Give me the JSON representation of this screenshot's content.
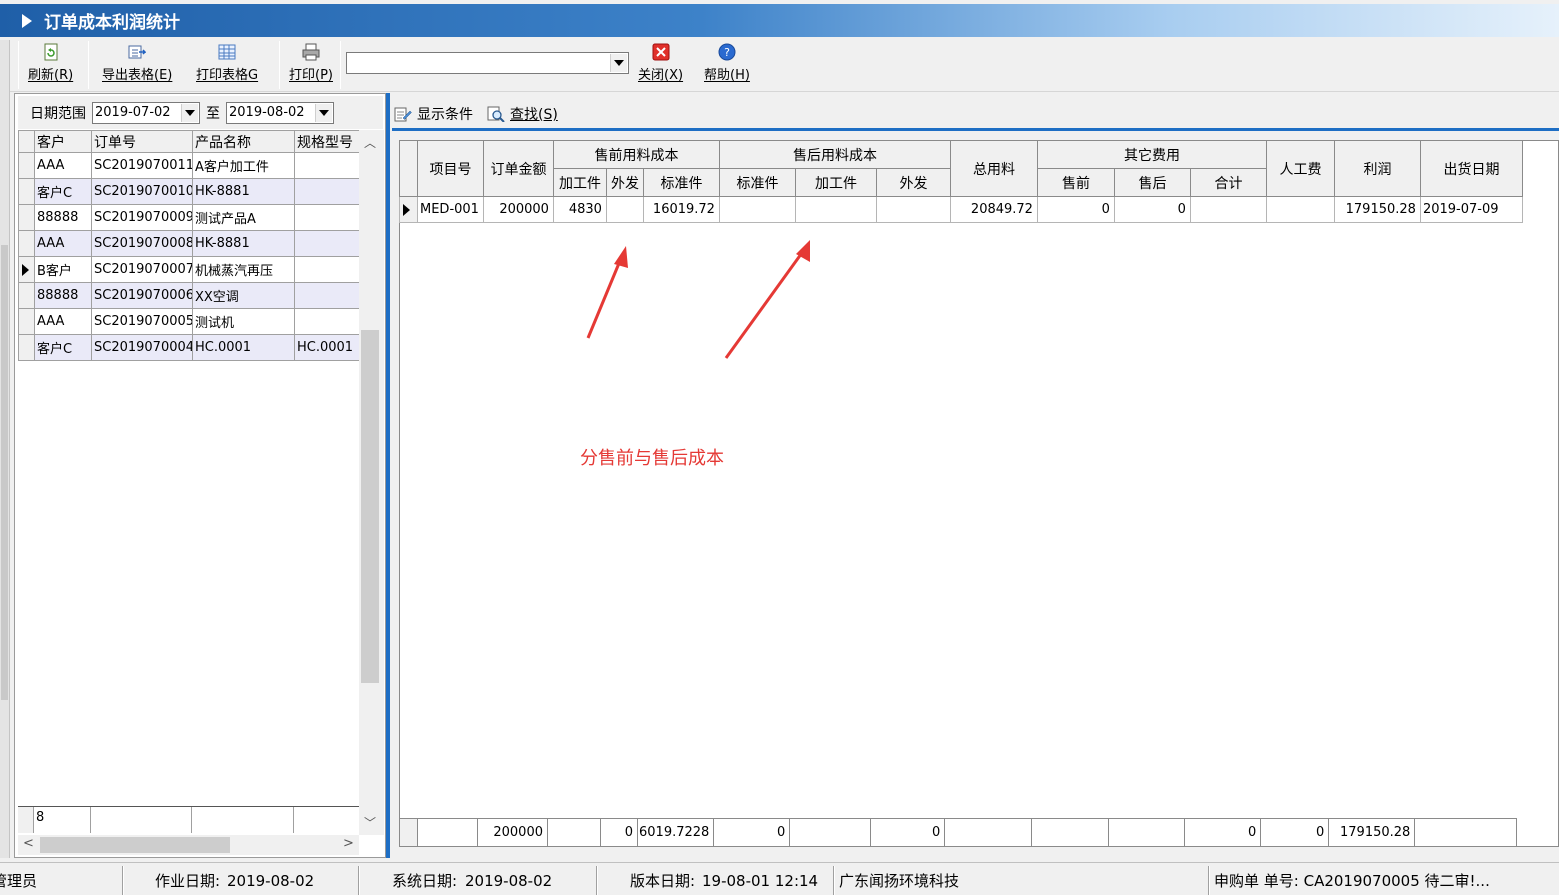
{
  "window": {
    "title": "订单成本利润统计"
  },
  "toolbar": {
    "refresh": "刷新(R)",
    "export": "导出表格(E)",
    "print_table": "打印表格G",
    "print": "打印(P)",
    "combo_value": "",
    "close": "关闭(X)",
    "help": "帮助(H)"
  },
  "filter": {
    "label": "日期范围",
    "from": "2019-07-02",
    "to_label": "至",
    "to": "2019-08-02"
  },
  "left_grid": {
    "columns": [
      "客户",
      "订单号",
      "产品名称",
      "规格型号"
    ],
    "rows": [
      [
        "AAA",
        "SC2019070011",
        "A客户加工件",
        ""
      ],
      [
        "客户C",
        "SC2019070010",
        "HK-8881",
        ""
      ],
      [
        "88888",
        "SC2019070009",
        "测试产品A",
        ""
      ],
      [
        "AAA",
        "SC2019070008",
        "HK-8881",
        ""
      ],
      [
        "B客户",
        "SC2019070007",
        "机械蒸汽再压",
        ""
      ],
      [
        "88888",
        "SC2019070006",
        "XX空调",
        ""
      ],
      [
        "AAA",
        "SC2019070005",
        "测试机",
        ""
      ],
      [
        "客户C",
        "SC2019070004",
        "HC.0001",
        "HC.0001"
      ]
    ],
    "footer_count": "8"
  },
  "right_toolbar": {
    "show_conditions": "显示条件",
    "find": "查找(S)"
  },
  "right_grid": {
    "headers": {
      "project_no": "项目号",
      "order_amount": "订单金额",
      "presale_group": "售前用料成本",
      "aftersale_group": "售后用料成本",
      "total_material": "总用料",
      "other_group": "其它费用",
      "labor": "人工费",
      "profit": "利润",
      "ship_date": "出货日期",
      "processing": "加工件",
      "outsourced": "外发",
      "standard": "标准件",
      "presale": "售前",
      "aftersale": "售后",
      "subtotal": "合计"
    },
    "row": {
      "project_no": "MED-001",
      "order_amount": "200000",
      "pre_processing": "4830",
      "pre_outsourced": "",
      "pre_standard": "16019.72",
      "after_standard": "",
      "after_processing": "",
      "after_outsourced": "",
      "total_material": "20849.72",
      "other_presale": "0",
      "other_aftersale": "0",
      "other_subtotal": "",
      "labor": "",
      "profit": "179150.28",
      "ship_date": "2019-07-09"
    },
    "footer": {
      "order_amount": "200000",
      "pre_outsourced": "0",
      "pre_standard": "6019.7228",
      "after_standard": "0",
      "after_outsourced": "0",
      "other_subtotal": "0",
      "labor": "0",
      "profit": "179150.28"
    }
  },
  "annotation": {
    "text": "分售前与售后成本"
  },
  "statusbar": {
    "user": "管理员",
    "work_date_label": "作业日期:",
    "work_date": "2019-08-02",
    "system_date_label": "系统日期:",
    "system_date": "2019-08-02",
    "version_date_label": "版本日期:",
    "version_date": "19-08-01 12:14",
    "company": "广东闻扬环境科技",
    "notice": "申购单 单号: CA2019070005 待二审!..."
  },
  "colors": {
    "accent": "#1e6ec4",
    "annotation": "#e53935",
    "row_alt": "#eaeaf8"
  }
}
